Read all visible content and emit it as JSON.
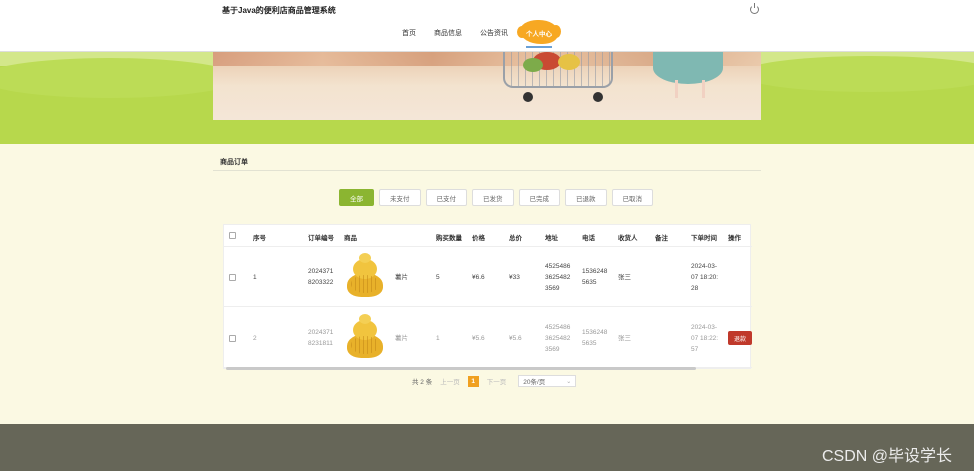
{
  "header": {
    "site_title": "基于Java的便利店商品管理系统"
  },
  "nav": {
    "items": [
      "首页",
      "商品信息",
      "公告资讯"
    ],
    "active": "个人中心"
  },
  "section": {
    "title": "商品订单"
  },
  "filters": [
    "全部",
    "未支付",
    "已支付",
    "已发货",
    "已完成",
    "已退款",
    "已取消"
  ],
  "table": {
    "headers": [
      "序号",
      "订单编号",
      "商品",
      "购买数量",
      "价格",
      "总价",
      "地址",
      "电话",
      "收货人",
      "备注",
      "下单时间",
      "操作"
    ],
    "rows": [
      {
        "index": "1",
        "order_no_1": "2024371",
        "order_no_2": "8203322",
        "product": "薯片",
        "qty": "5",
        "price": "¥6.6",
        "total": "¥33",
        "addr_1": "4525486",
        "addr_2": "3625482",
        "addr_3": "3569",
        "phone_1": "1536248",
        "phone_2": "5635",
        "receiver": "张三",
        "time_1": "2024-03-",
        "time_2": "07 18:20:",
        "time_3": "28"
      },
      {
        "index": "2",
        "order_no_1": "2024371",
        "order_no_2": "8231811",
        "product": "薯片",
        "qty": "1",
        "price": "¥5.6",
        "total": "¥5.6",
        "addr_1": "4525486",
        "addr_2": "3625482",
        "addr_3": "3569",
        "phone_1": "1536248",
        "phone_2": "5635",
        "receiver": "张三",
        "time_1": "2024-03-",
        "time_2": "07 18:22:",
        "time_3": "57",
        "action": "退款"
      }
    ]
  },
  "pager": {
    "total": "共 2 条",
    "prev": "上一页",
    "current": "1",
    "next": "下一页",
    "size": "20条/页"
  },
  "watermark": "CSDN @毕设学长",
  "colors": {
    "accent": "#8bb531",
    "band": "#b7d84c",
    "refund": "#c0392b",
    "page_current": "#f0a020"
  },
  "icons": [
    "power-icon",
    "chevron-down-icon",
    "checkbox"
  ]
}
